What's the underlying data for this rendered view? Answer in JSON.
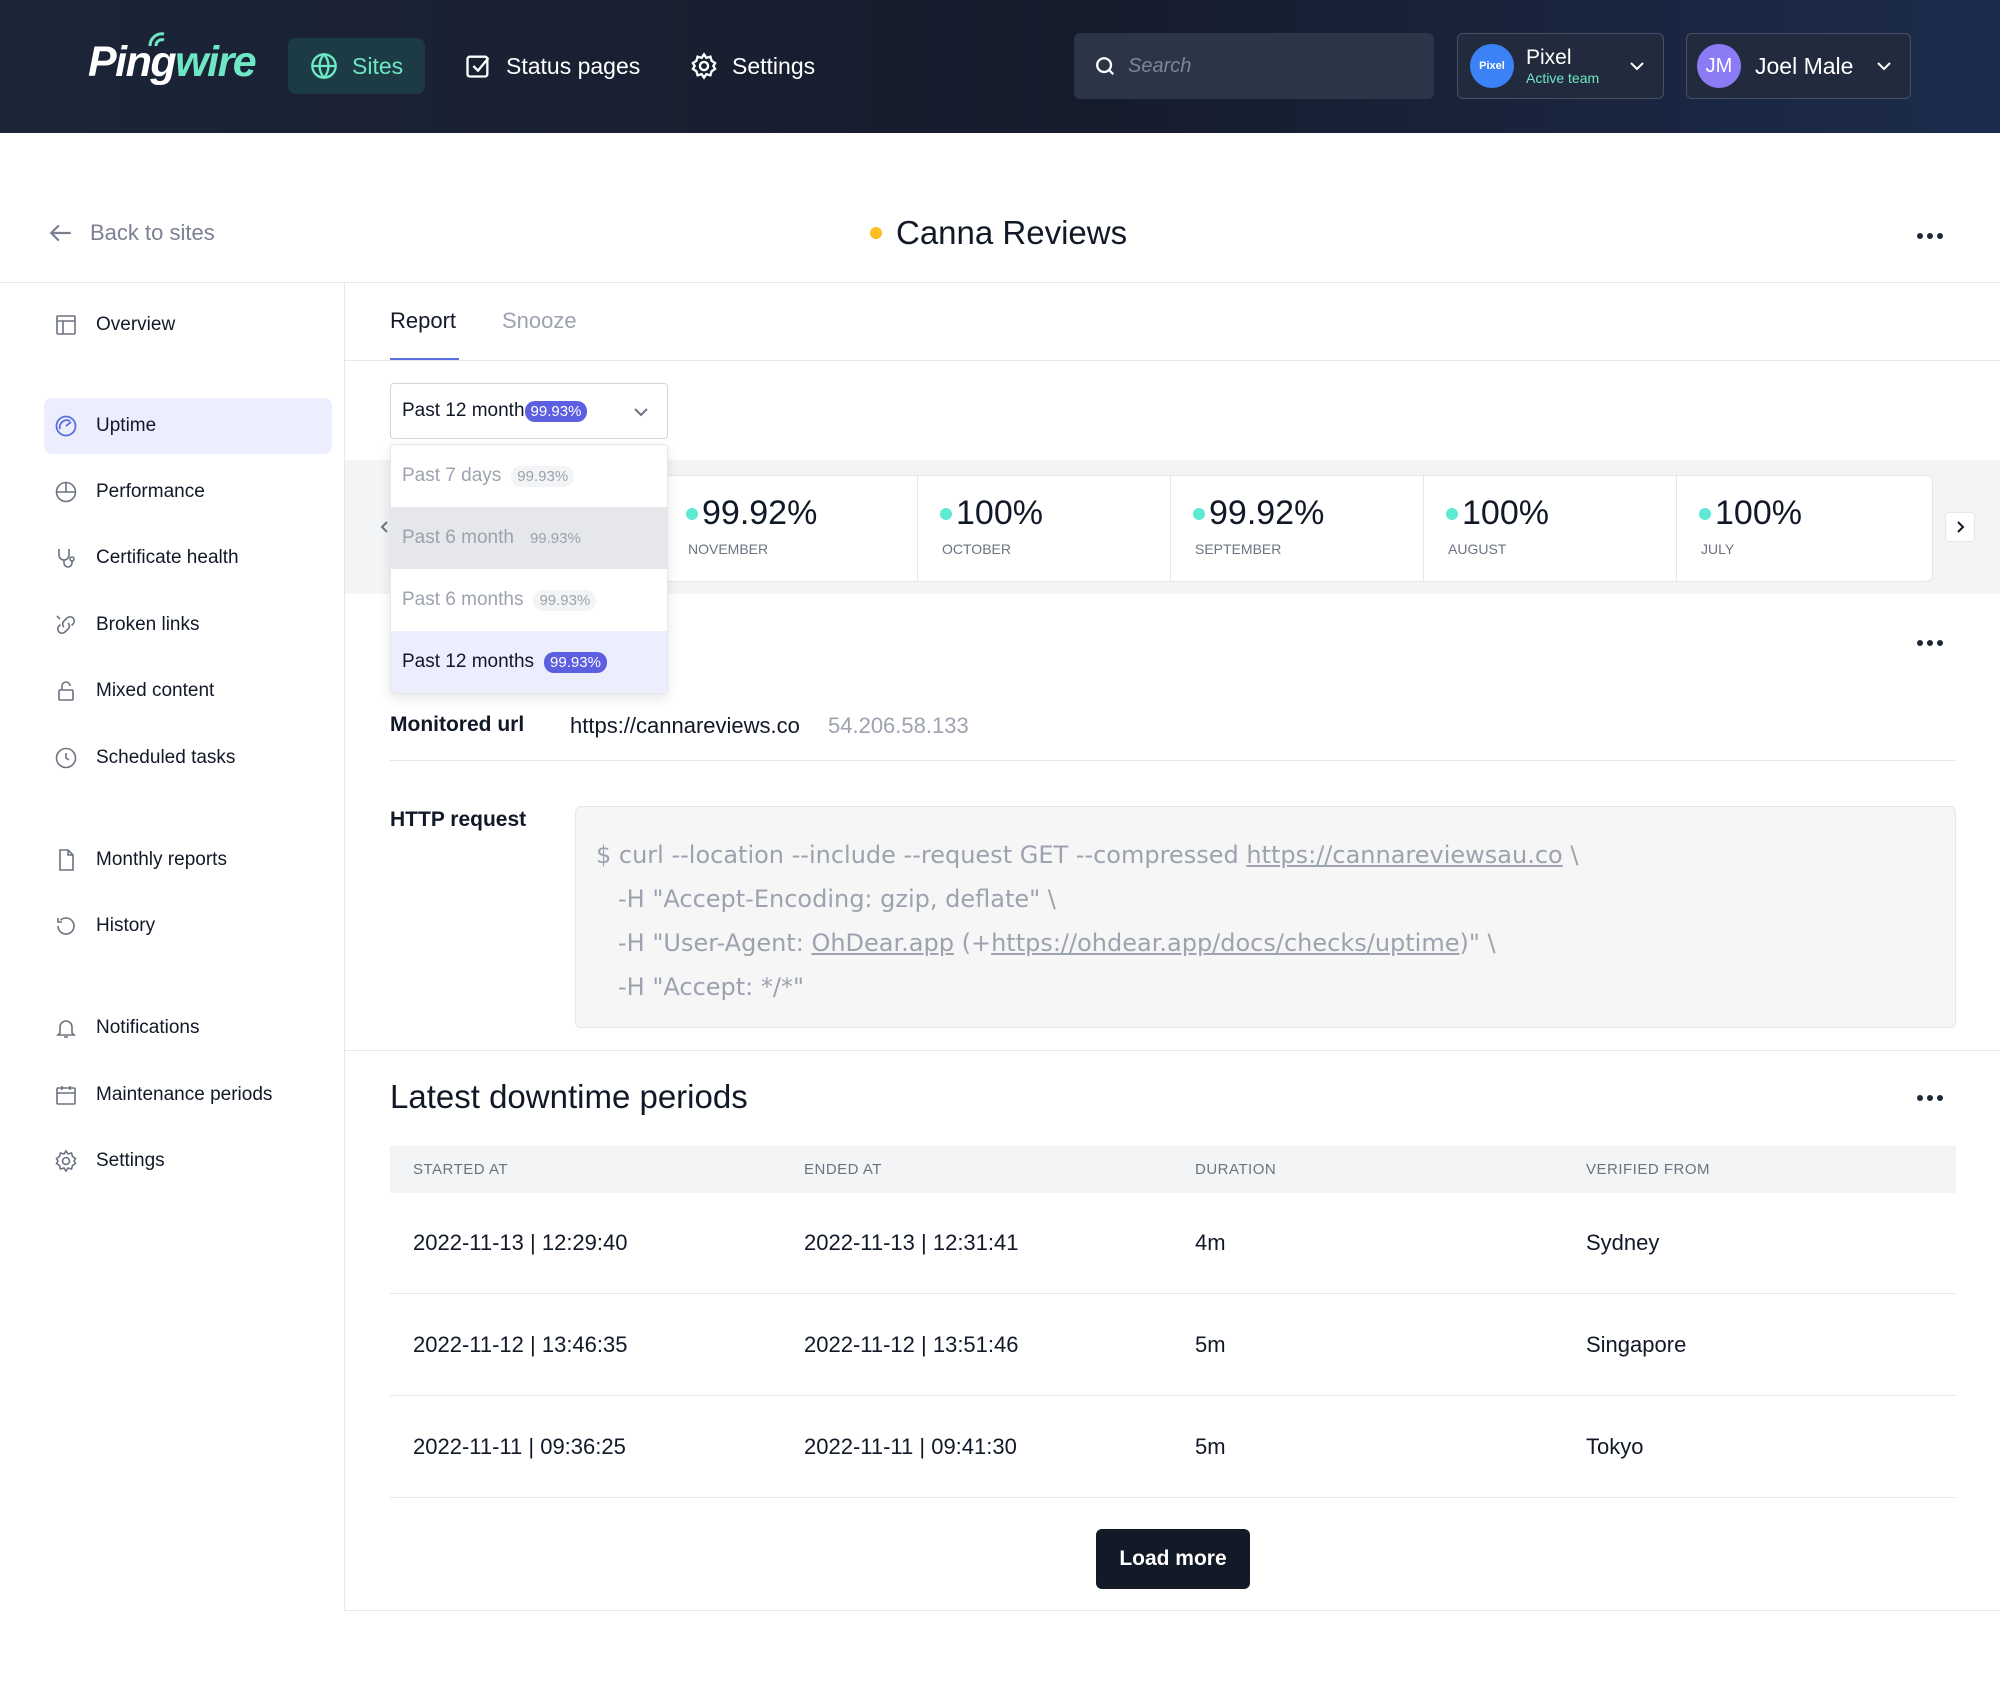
{
  "app": {
    "logo_prefix": "Ping",
    "logo_suffix": "wire"
  },
  "nav": {
    "sites": "Sites",
    "status_pages": "Status pages",
    "settings": "Settings"
  },
  "search": {
    "placeholder": "Search"
  },
  "team": {
    "badge": "Pixel",
    "name": "Pixel",
    "subtitle": "Active team"
  },
  "user": {
    "initials": "JM",
    "name": "Joel Male"
  },
  "page": {
    "back_label": "Back to sites",
    "site_name": "Canna Reviews",
    "site_status_color": "#fbbf24"
  },
  "sidebar": {
    "items": [
      {
        "label": "Overview"
      },
      {
        "label": "Uptime"
      },
      {
        "label": "Performance"
      },
      {
        "label": "Certificate health"
      },
      {
        "label": "Broken links"
      },
      {
        "label": "Mixed content"
      },
      {
        "label": "Scheduled tasks"
      },
      {
        "label": "Monthly reports"
      },
      {
        "label": "History"
      },
      {
        "label": "Notifications"
      },
      {
        "label": "Maintenance periods"
      },
      {
        "label": "Settings"
      }
    ],
    "active": "Uptime"
  },
  "tabs": {
    "report": "Report",
    "snooze": "Snooze"
  },
  "period_select": {
    "value": "Past 12 month",
    "value_pct": "99.93%",
    "options": [
      {
        "label": "Past 7 days",
        "pct": "99.93%"
      },
      {
        "label": "Past 6 month",
        "pct": "99.93%"
      },
      {
        "label": "Past 6 months",
        "pct": "99.93%"
      },
      {
        "label": "Past 12 months",
        "pct": "99.93%"
      }
    ]
  },
  "months": [
    {
      "value": "99.92%",
      "name": "NOVEMBER"
    },
    {
      "value": "100%",
      "name": "OCTOBER"
    },
    {
      "value": "99.92%",
      "name": "SEPTEMBER"
    },
    {
      "value": "100%",
      "name": "AUGUST"
    },
    {
      "value": "100%",
      "name": "JULY"
    }
  ],
  "monitor": {
    "url_label": "Monitored url",
    "url": "https://cannareviews.co",
    "ip": "54.206.58.133",
    "http_label": "HTTP request",
    "curl_prefix": "$ curl --location --include --request GET --compressed ",
    "curl_url": "https://cannareviewsau.co",
    "curl_suffix": " \\",
    "header1": "-H \"Accept-Encoding: gzip, deflate\" \\",
    "header2_a": "-H \"User-Agent: ",
    "header2_link1": "OhDear.app",
    "header2_b": " (+",
    "header2_link2": "https://ohdear.app/docs/checks/uptime",
    "header2_c": ")\" \\",
    "header3": "-H \"Accept: */*\""
  },
  "downtime": {
    "title": "Latest downtime periods",
    "columns": [
      "STARTED AT",
      "ENDED AT",
      "DURATION",
      "VERIFIED FROM"
    ],
    "rows": [
      [
        "2022-11-13 | 12:29:40",
        "2022-11-13 | 12:31:41",
        "4m",
        "Sydney"
      ],
      [
        "2022-11-12 | 13:46:35",
        "2022-11-12 | 13:51:46",
        "5m",
        "Singapore"
      ],
      [
        "2022-11-11 | 09:36:25",
        "2022-11-11 | 09:41:30",
        "5m",
        "Tokyo"
      ]
    ],
    "load_more": "Load more"
  }
}
